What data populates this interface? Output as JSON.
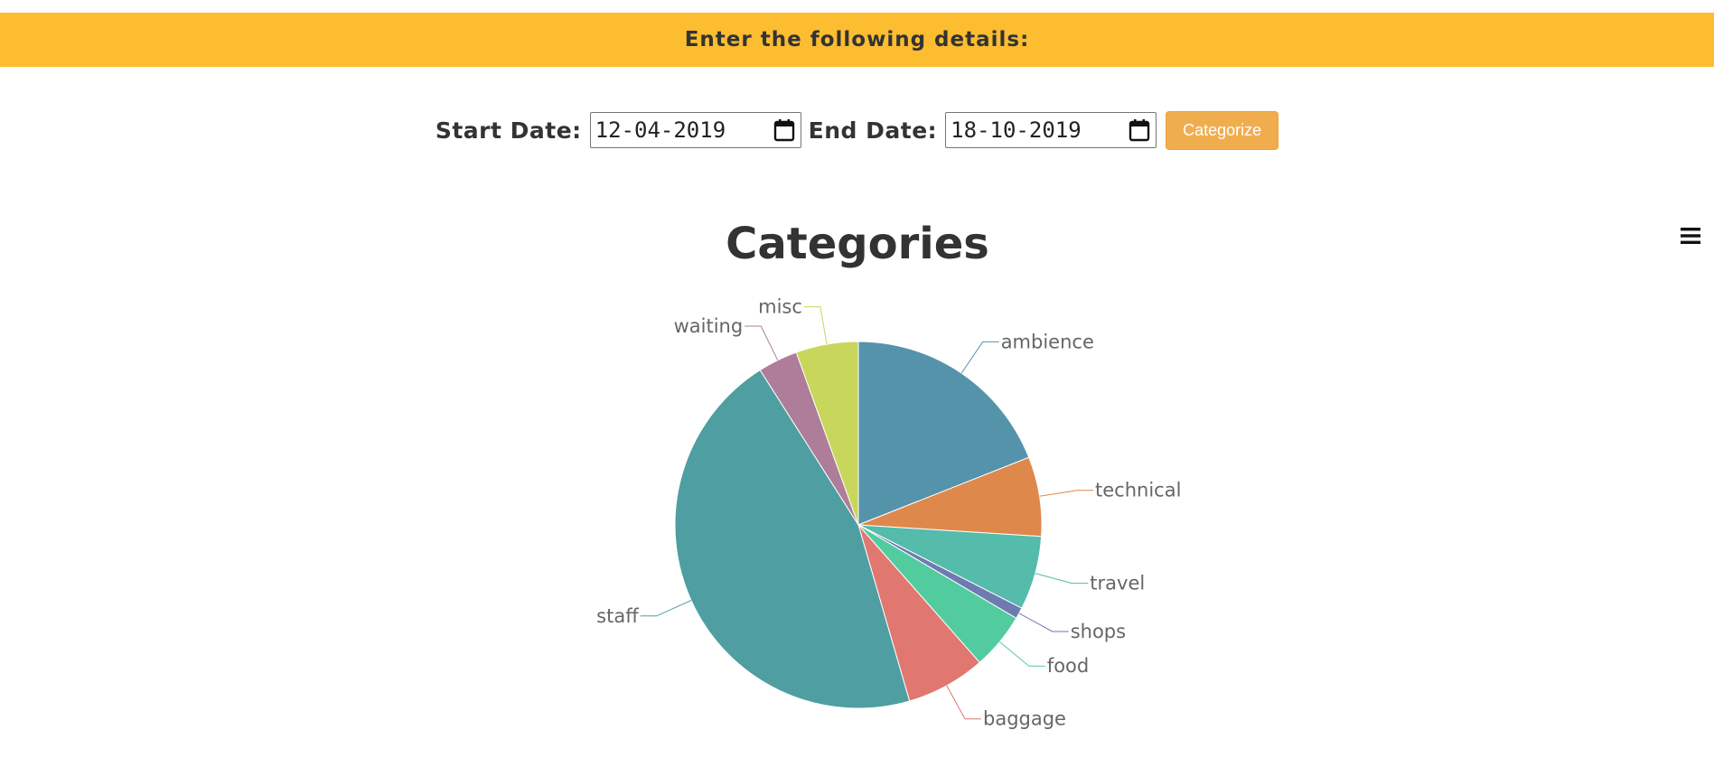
{
  "header": {
    "banner_text": "Enter the following details:"
  },
  "form": {
    "start_label": "Start Date:",
    "start_value": "12-04-2019",
    "end_label": "End Date:",
    "end_value": "18-10-2019",
    "submit_label": "Categorize"
  },
  "icons": {
    "calendar": "calendar-icon",
    "menu": "hamburger-menu-icon"
  },
  "colors": {
    "banner": "#fdbd30",
    "button": "#f0ad4e"
  },
  "chart_data": {
    "type": "pie",
    "title": "Categories",
    "legend": "none (data labels with connectors)",
    "slices": [
      {
        "name": "ambience",
        "value": 19.0,
        "color": "#5593ab"
      },
      {
        "name": "technical",
        "value": 7.0,
        "color": "#de884c"
      },
      {
        "name": "travel",
        "value": 6.5,
        "color": "#55bbab"
      },
      {
        "name": "shops",
        "value": 1.0,
        "color": "#6e7bb0"
      },
      {
        "name": "food",
        "value": 5.0,
        "color": "#52cc9f"
      },
      {
        "name": "baggage",
        "value": 7.0,
        "color": "#e07770"
      },
      {
        "name": "staff",
        "value": 45.5,
        "color": "#4f9ea1"
      },
      {
        "name": "waiting",
        "value": 3.5,
        "color": "#ad7d99"
      },
      {
        "name": "misc",
        "value": 5.5,
        "color": "#c9d65c"
      }
    ]
  }
}
